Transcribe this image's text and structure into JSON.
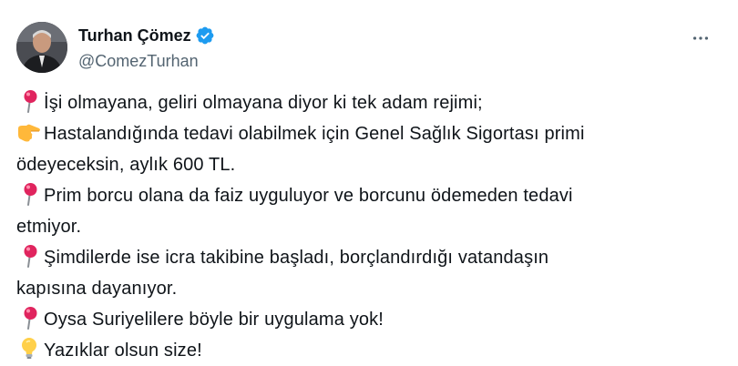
{
  "author": {
    "display_name": "Turhan Çömez",
    "handle": "@ComezTurhan",
    "verified": true,
    "verified_color": "#1d9bf0"
  },
  "more_icon": "more-horizontal-icon",
  "tweet": {
    "lines": [
      {
        "emoji": "round-pushpin",
        "text": "İşi olmayana, geliri olmayana diyor ki tek adam rejimi;"
      },
      {
        "emoji": "backhand-index-pointing-right",
        "text": "Hastalandığında tedavi olabilmek için Genel Sağlık Sigortası primi"
      },
      {
        "emoji": "",
        "text": "ödeyeceksin, aylık 600 TL."
      },
      {
        "emoji": "round-pushpin",
        "text": "Prim borcu olana da faiz uyguluyor ve borcunu ödemeden tedavi"
      },
      {
        "emoji": "",
        "text": "etmiyor."
      },
      {
        "emoji": "round-pushpin",
        "text": "Şimdilerde ise icra takibine başladı, borçlandırdığı vatandaşın"
      },
      {
        "emoji": "",
        "text": "kapısına dayanıyor."
      },
      {
        "emoji": "round-pushpin",
        "text": "Oysa Suriyelilere böyle bir uygulama yok!"
      },
      {
        "emoji": "light-bulb",
        "text": "Yazıklar olsun size!"
      }
    ]
  },
  "colors": {
    "text": "#0f1419",
    "secondary": "#536471",
    "pin_red": "#e0245e",
    "hand_yellow": "#ffb83a",
    "bulb_yellow": "#ffd04a"
  }
}
